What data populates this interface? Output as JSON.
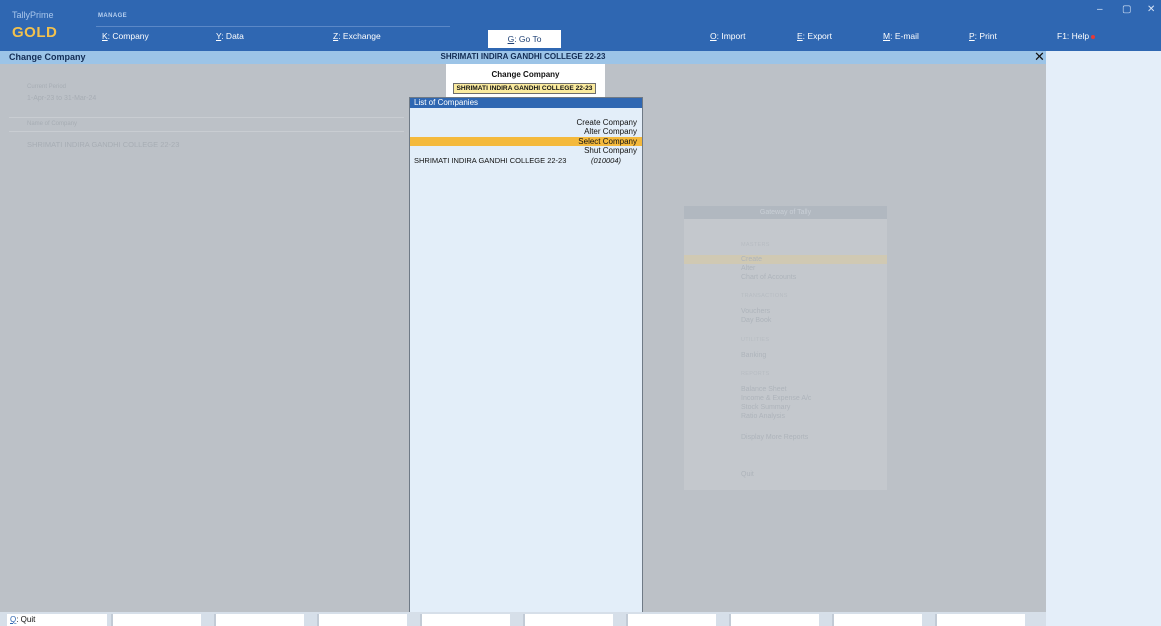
{
  "brand": {
    "name": "TallyPrime",
    "edition": "GOLD"
  },
  "topbar": {
    "manage_label": "MANAGE",
    "menu": [
      {
        "key": "K",
        "label": ": Company"
      },
      {
        "key": "Y",
        "label": ": Data"
      },
      {
        "key": "Z",
        "label": ": Exchange"
      },
      {
        "key": "G",
        "label": ": Go To"
      },
      {
        "key": "O",
        "label": ": Import"
      },
      {
        "key": "E",
        "label": ": Export"
      },
      {
        "key": "M",
        "label": ": E-mail"
      },
      {
        "key": "P",
        "label": ": Print"
      },
      {
        "key": "F1",
        "label": ": Help"
      }
    ],
    "window_controls": {
      "minimize": "–",
      "restore": "▢",
      "close": "✕"
    }
  },
  "titlebar": {
    "screen_title": "Change Company",
    "company_title": "SHRIMATI INDIRA GANDHI COLLEGE 22-23",
    "close_glyph": "✕"
  },
  "background_info": {
    "current_period_label": "Current Period",
    "current_period_value": "1-Apr-23 to 31-Mar-24",
    "name_of_company_label": "Name of Company",
    "company_name": "SHRIMATI INDIRA GANDHI COLLEGE 22-23"
  },
  "gateway": {
    "title": "Gateway of Tally",
    "sections": [
      {
        "heading": "MASTERS",
        "items": [
          "Create",
          "Alter",
          "Chart of Accounts"
        ]
      },
      {
        "heading": "TRANSACTIONS",
        "items": [
          "Vouchers",
          "Day Book"
        ]
      },
      {
        "heading": "UTILITIES",
        "items": [
          "Banking"
        ]
      },
      {
        "heading": "REPORTS",
        "items": [
          "Balance Sheet",
          "Income & Expense A/c",
          "Stock Summary",
          "Ratio Analysis"
        ]
      }
    ],
    "display_more": "Display More Reports",
    "quit": "Quit"
  },
  "change_form": {
    "title": "Change Company",
    "value": "SHRIMATI INDIRA GANDHI COLLEGE 22-23"
  },
  "company_list": {
    "title": "List of Companies",
    "actions": [
      "Create Company",
      "Alter Company",
      "Select Company",
      "Shut Company"
    ],
    "selected_action": "Select Company",
    "companies": [
      {
        "name": "SHRIMATI INDIRA GANDHI COLLEGE 22-23",
        "code": "(010004)"
      }
    ]
  },
  "bottom_bar": {
    "quit_key": "Q",
    "quit_label": ": Quit"
  },
  "colors": {
    "topbar": "#2f67b2",
    "titlebar": "#9cc4e7",
    "highlight": "#f4b93c",
    "input_fill": "#fbeb9f",
    "edition": "#f2c14e"
  }
}
